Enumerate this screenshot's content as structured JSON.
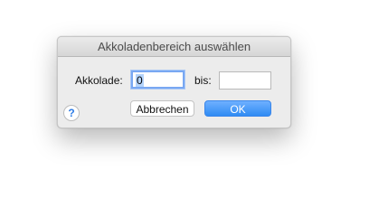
{
  "dialog": {
    "title": "Akkoladenbereich auswählen",
    "from_label": "Akkolade:",
    "from_value": "0",
    "to_label": "bis:",
    "to_value": "",
    "cancel_label": "Abbrechen",
    "ok_label": "OK",
    "help_glyph": "?"
  },
  "icons": {
    "help": "question-mark-icon"
  },
  "colors": {
    "accent": "#2f8bf3",
    "focus_ring": "#79a8f2"
  }
}
